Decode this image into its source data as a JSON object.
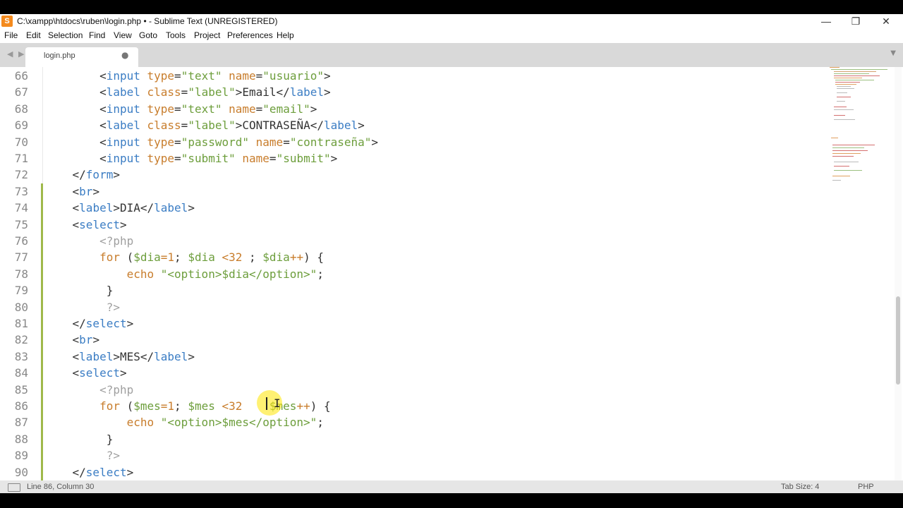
{
  "window": {
    "title": "C:\\xampp\\htdocs\\ruben\\login.php • - Sublime Text (UNREGISTERED)",
    "app_icon_letter": "S",
    "minimize_glyph": "—",
    "restore_glyph": "❐",
    "close_glyph": "✕"
  },
  "menu": {
    "items": [
      "File",
      "Edit",
      "Selection",
      "Find",
      "View",
      "Goto",
      "Tools",
      "Project",
      "Preferences",
      "Help"
    ]
  },
  "tabs": {
    "nav_arrows": "◀ ▶",
    "active_tab": "login.php",
    "dirty_glyph": "●",
    "dropdown_glyph": "▼"
  },
  "code": {
    "first_line_number": 66,
    "modified_lines": [
      73,
      74,
      75,
      76,
      77,
      78,
      79,
      80,
      81,
      82,
      83,
      84,
      85,
      86,
      87,
      88,
      89,
      90
    ],
    "lines": [
      {
        "num": "66",
        "tokens": [
          [
            "t",
            "        <"
          ],
          [
            "n",
            "input"
          ],
          [
            "a",
            " type"
          ],
          [
            "t",
            "="
          ],
          [
            "s",
            "\"text\""
          ],
          [
            "a",
            " name"
          ],
          [
            "t",
            "="
          ],
          [
            "s",
            "\"usuario\""
          ],
          [
            "t",
            ">"
          ]
        ]
      },
      {
        "num": "67",
        "tokens": [
          [
            "t",
            "        <"
          ],
          [
            "n",
            "label"
          ],
          [
            "a",
            " class"
          ],
          [
            "t",
            "="
          ],
          [
            "s",
            "\"label\""
          ],
          [
            "t",
            ">Email</"
          ],
          [
            "n",
            "label"
          ],
          [
            "t",
            ">"
          ]
        ]
      },
      {
        "num": "68",
        "tokens": [
          [
            "t",
            "        <"
          ],
          [
            "n",
            "input"
          ],
          [
            "a",
            " type"
          ],
          [
            "t",
            "="
          ],
          [
            "s",
            "\"text\""
          ],
          [
            "a",
            " name"
          ],
          [
            "t",
            "="
          ],
          [
            "s",
            "\"email\""
          ],
          [
            "t",
            ">"
          ]
        ]
      },
      {
        "num": "69",
        "tokens": [
          [
            "t",
            "        <"
          ],
          [
            "n",
            "label"
          ],
          [
            "a",
            " class"
          ],
          [
            "t",
            "="
          ],
          [
            "s",
            "\"label\""
          ],
          [
            "t",
            ">CONTRASEÑA</"
          ],
          [
            "n",
            "label"
          ],
          [
            "t",
            ">"
          ]
        ]
      },
      {
        "num": "70",
        "tokens": [
          [
            "t",
            "        <"
          ],
          [
            "n",
            "input"
          ],
          [
            "a",
            " type"
          ],
          [
            "t",
            "="
          ],
          [
            "s",
            "\"password\""
          ],
          [
            "a",
            " name"
          ],
          [
            "t",
            "="
          ],
          [
            "s",
            "\"contraseña\""
          ],
          [
            "t",
            ">"
          ]
        ]
      },
      {
        "num": "71",
        "tokens": [
          [
            "t",
            "        <"
          ],
          [
            "n",
            "input"
          ],
          [
            "a",
            " type"
          ],
          [
            "t",
            "="
          ],
          [
            "s",
            "\"submit\""
          ],
          [
            "a",
            " name"
          ],
          [
            "t",
            "="
          ],
          [
            "s",
            "\"submit\""
          ],
          [
            "t",
            ">"
          ]
        ]
      },
      {
        "num": "72",
        "tokens": [
          [
            "t",
            "    </"
          ],
          [
            "n",
            "form"
          ],
          [
            "t",
            ">"
          ]
        ]
      },
      {
        "num": "73",
        "tokens": [
          [
            "t",
            "    <"
          ],
          [
            "n",
            "br"
          ],
          [
            "t",
            ">"
          ]
        ]
      },
      {
        "num": "74",
        "tokens": [
          [
            "t",
            "    <"
          ],
          [
            "n",
            "label"
          ],
          [
            "t",
            ">DIA</"
          ],
          [
            "n",
            "label"
          ],
          [
            "t",
            ">"
          ]
        ]
      },
      {
        "num": "75",
        "tokens": [
          [
            "t",
            "    <"
          ],
          [
            "n",
            "select"
          ],
          [
            "t",
            ">"
          ]
        ]
      },
      {
        "num": "76",
        "tokens": [
          [
            "x",
            "        <?php"
          ]
        ]
      },
      {
        "num": "77",
        "tokens": [
          [
            "k",
            "        for"
          ],
          [
            "t",
            " ("
          ],
          [
            "v",
            "$dia"
          ],
          [
            "k",
            "="
          ],
          [
            "a",
            "1"
          ],
          [
            "t",
            "; "
          ],
          [
            "v",
            "$dia"
          ],
          [
            "k",
            " <"
          ],
          [
            "a",
            "32"
          ],
          [
            "t",
            " ; "
          ],
          [
            "v",
            "$dia"
          ],
          [
            "k",
            "++"
          ],
          [
            "t",
            ") {"
          ]
        ]
      },
      {
        "num": "78",
        "tokens": [
          [
            "k",
            "            echo"
          ],
          [
            "s",
            " \"<option>"
          ],
          [
            "v",
            "$dia"
          ],
          [
            "s",
            "</option>\""
          ],
          [
            "t",
            ";"
          ]
        ]
      },
      {
        "num": "79",
        "tokens": [
          [
            "t",
            "         }"
          ]
        ]
      },
      {
        "num": "80",
        "tokens": [
          [
            "x",
            "         ?>"
          ]
        ]
      },
      {
        "num": "81",
        "tokens": [
          [
            "t",
            "    </"
          ],
          [
            "n",
            "select"
          ],
          [
            "t",
            ">"
          ]
        ]
      },
      {
        "num": "82",
        "tokens": [
          [
            "t",
            "    <"
          ],
          [
            "n",
            "br"
          ],
          [
            "t",
            ">"
          ]
        ]
      },
      {
        "num": "83",
        "tokens": [
          [
            "t",
            "    <"
          ],
          [
            "n",
            "label"
          ],
          [
            "t",
            ">MES</"
          ],
          [
            "n",
            "label"
          ],
          [
            "t",
            ">"
          ]
        ]
      },
      {
        "num": "84",
        "tokens": [
          [
            "t",
            "    <"
          ],
          [
            "n",
            "select"
          ],
          [
            "t",
            ">"
          ]
        ]
      },
      {
        "num": "85",
        "tokens": [
          [
            "x",
            "        <?php"
          ]
        ]
      },
      {
        "num": "86",
        "tokens": [
          [
            "k",
            "        for"
          ],
          [
            "t",
            " ("
          ],
          [
            "v",
            "$mes"
          ],
          [
            "k",
            "="
          ],
          [
            "a",
            "1"
          ],
          [
            "t",
            "; "
          ],
          [
            "v",
            "$mes"
          ],
          [
            "k",
            " <"
          ],
          [
            "a",
            "32"
          ],
          [
            "t",
            "    "
          ],
          [
            "v",
            "$mes"
          ],
          [
            "k",
            "++"
          ],
          [
            "t",
            ") {"
          ]
        ]
      },
      {
        "num": "87",
        "tokens": [
          [
            "k",
            "            echo"
          ],
          [
            "s",
            " \"<option>"
          ],
          [
            "v",
            "$mes"
          ],
          [
            "s",
            "</option>\""
          ],
          [
            "t",
            ";"
          ]
        ]
      },
      {
        "num": "88",
        "tokens": [
          [
            "t",
            "         }"
          ]
        ]
      },
      {
        "num": "89",
        "tokens": [
          [
            "x",
            "         ?>"
          ]
        ]
      },
      {
        "num": "90",
        "tokens": [
          [
            "t",
            "    </"
          ],
          [
            "n",
            "select"
          ],
          [
            "t",
            ">"
          ]
        ]
      }
    ]
  },
  "cursor": {
    "line": 86,
    "column": 30,
    "ibeam_glyph": "I"
  },
  "status": {
    "position": "Line 86, Column 30",
    "tab_size": "Tab Size: 4",
    "syntax": "PHP"
  },
  "colors": {
    "tag": "#3b7dc4",
    "attribute": "#c87d2c",
    "string": "#6d9e3c",
    "modified_marker": "#9fb94a"
  }
}
